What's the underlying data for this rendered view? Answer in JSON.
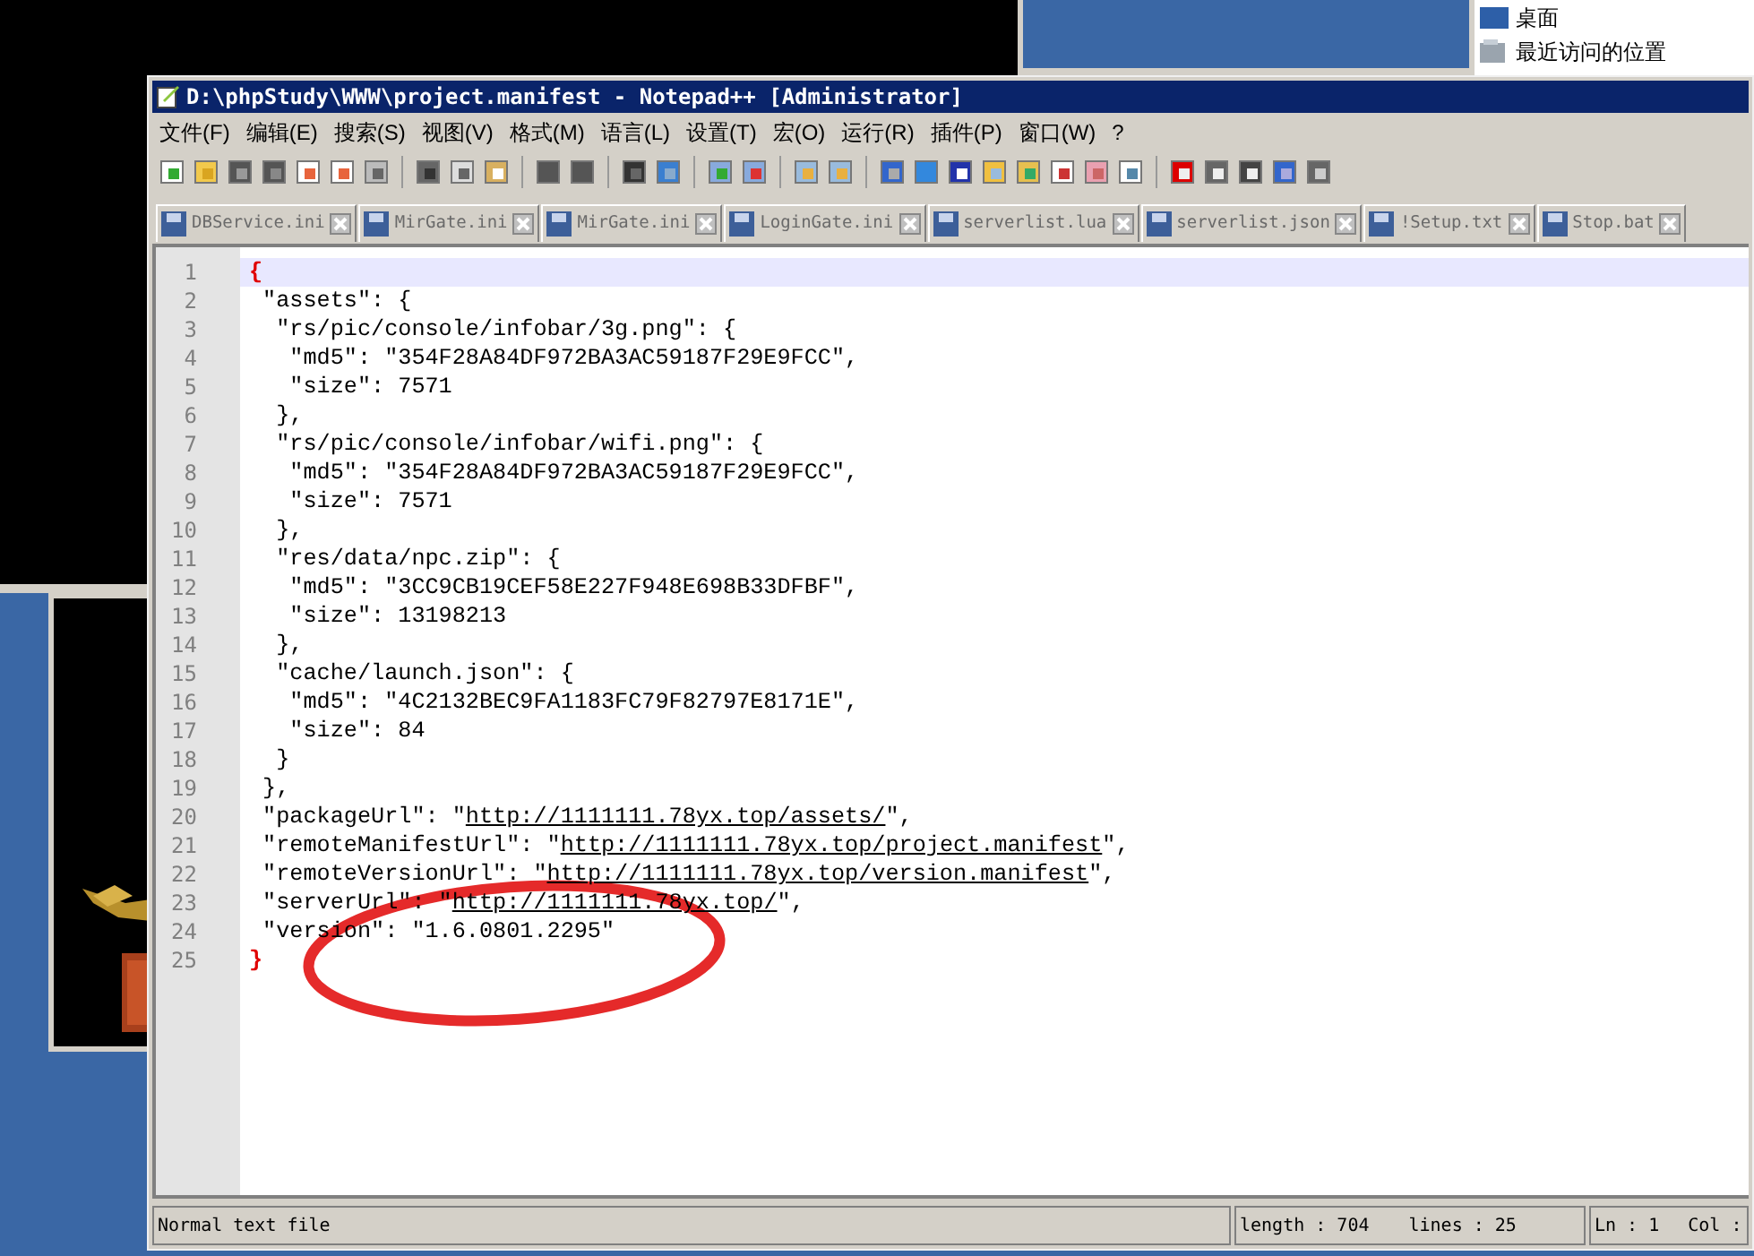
{
  "desktop": {
    "explorer_items": [
      "桌面",
      "最近访问的位置"
    ]
  },
  "window": {
    "title": "D:\\phpStudy\\WWW\\project.manifest - Notepad++ [Administrator]"
  },
  "menu": [
    "文件(F)",
    "编辑(E)",
    "搜索(S)",
    "视图(V)",
    "格式(M)",
    "语言(L)",
    "设置(T)",
    "宏(O)",
    "运行(R)",
    "插件(P)",
    "窗口(W)",
    "?"
  ],
  "tabs": [
    {
      "label": "DBService.ini"
    },
    {
      "label": "MirGate.ini"
    },
    {
      "label": "MirGate.ini"
    },
    {
      "label": "LoginGate.ini"
    },
    {
      "label": "serverlist.lua"
    },
    {
      "label": "serverlist.json"
    },
    {
      "label": "!Setup.txt"
    },
    {
      "label": "Stop.bat"
    }
  ],
  "editor": {
    "lines": [
      {
        "number": "1",
        "current": true,
        "segments": [
          {
            "kind": "brace",
            "text": "{"
          }
        ]
      },
      {
        "number": "2",
        "current": false,
        "segments": [
          {
            "kind": "text",
            "text": " \"assets\": {"
          }
        ]
      },
      {
        "number": "3",
        "current": false,
        "segments": [
          {
            "kind": "text",
            "text": "  \"rs/pic/console/infobar/3g.png\": {"
          }
        ]
      },
      {
        "number": "4",
        "current": false,
        "segments": [
          {
            "kind": "text",
            "text": "   \"md5\": \"354F28A84DF972BA3AC59187F29E9FCC\","
          }
        ]
      },
      {
        "number": "5",
        "current": false,
        "segments": [
          {
            "kind": "text",
            "text": "   \"size\": 7571"
          }
        ]
      },
      {
        "number": "6",
        "current": false,
        "segments": [
          {
            "kind": "text",
            "text": "  },"
          }
        ]
      },
      {
        "number": "7",
        "current": false,
        "segments": [
          {
            "kind": "text",
            "text": "  \"rs/pic/console/infobar/wifi.png\": {"
          }
        ]
      },
      {
        "number": "8",
        "current": false,
        "segments": [
          {
            "kind": "text",
            "text": "   \"md5\": \"354F28A84DF972BA3AC59187F29E9FCC\","
          }
        ]
      },
      {
        "number": "9",
        "current": false,
        "segments": [
          {
            "kind": "text",
            "text": "   \"size\": 7571"
          }
        ]
      },
      {
        "number": "10",
        "current": false,
        "segments": [
          {
            "kind": "text",
            "text": "  },"
          }
        ]
      },
      {
        "number": "11",
        "current": false,
        "segments": [
          {
            "kind": "text",
            "text": "  \"res/data/npc.zip\": {"
          }
        ]
      },
      {
        "number": "12",
        "current": false,
        "segments": [
          {
            "kind": "text",
            "text": "   \"md5\": \"3CC9CB19CEF58E227F948E698B33DFBF\","
          }
        ]
      },
      {
        "number": "13",
        "current": false,
        "segments": [
          {
            "kind": "text",
            "text": "   \"size\": 13198213"
          }
        ]
      },
      {
        "number": "14",
        "current": false,
        "segments": [
          {
            "kind": "text",
            "text": "  },"
          }
        ]
      },
      {
        "number": "15",
        "current": false,
        "segments": [
          {
            "kind": "text",
            "text": "  \"cache/launch.json\": {"
          }
        ]
      },
      {
        "number": "16",
        "current": false,
        "segments": [
          {
            "kind": "text",
            "text": "   \"md5\": \"4C2132BEC9FA1183FC79F82797E8171E\","
          }
        ]
      },
      {
        "number": "17",
        "current": false,
        "segments": [
          {
            "kind": "text",
            "text": "   \"size\": 84"
          }
        ]
      },
      {
        "number": "18",
        "current": false,
        "segments": [
          {
            "kind": "text",
            "text": "  }"
          }
        ]
      },
      {
        "number": "19",
        "current": false,
        "segments": [
          {
            "kind": "text",
            "text": " },"
          }
        ]
      },
      {
        "number": "20",
        "current": false,
        "segments": [
          {
            "kind": "text",
            "text": " \"packageUrl\": \""
          },
          {
            "kind": "link",
            "text": "http://1111111.78yx.top/assets/"
          },
          {
            "kind": "text",
            "text": "\","
          }
        ]
      },
      {
        "number": "21",
        "current": false,
        "segments": [
          {
            "kind": "text",
            "text": " \"remoteManifestUrl\": \""
          },
          {
            "kind": "link",
            "text": "http://1111111.78yx.top/project.manifest"
          },
          {
            "kind": "text",
            "text": "\","
          }
        ]
      },
      {
        "number": "22",
        "current": false,
        "segments": [
          {
            "kind": "text",
            "text": " \"remoteVersionUrl\": \""
          },
          {
            "kind": "link",
            "text": "http://1111111.78yx.top/version.manifest"
          },
          {
            "kind": "text",
            "text": "\","
          }
        ]
      },
      {
        "number": "23",
        "current": false,
        "segments": [
          {
            "kind": "text",
            "text": " \"serverUrl\": \""
          },
          {
            "kind": "link",
            "text": "http://1111111.78yx.top/"
          },
          {
            "kind": "text",
            "text": "\","
          }
        ]
      },
      {
        "number": "24",
        "current": false,
        "segments": [
          {
            "kind": "text",
            "text": " \"version\": \"1.6.0801.2295\""
          }
        ]
      },
      {
        "number": "25",
        "current": false,
        "segments": [
          {
            "kind": "brace",
            "text": "}"
          }
        ]
      }
    ]
  },
  "annotations": [
    {
      "kind": "ellipse"
    }
  ],
  "status_bar": {
    "file_type": "Normal text file",
    "length": "length : 704",
    "lines": "lines : 25",
    "position": "Ln : 1",
    "column": "Col :"
  }
}
